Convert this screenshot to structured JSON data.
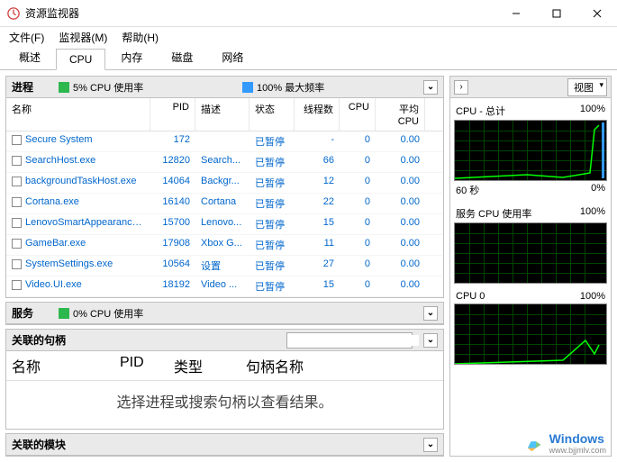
{
  "window": {
    "title": "资源监视器"
  },
  "menu": {
    "file": "文件(F)",
    "monitor": "监视器(M)",
    "help": "帮助(H)"
  },
  "tabs": [
    "概述",
    "CPU",
    "内存",
    "磁盘",
    "网络"
  ],
  "active_tab": "CPU",
  "processes": {
    "title": "进程",
    "legend1_box_color": "#2db84d",
    "legend1_text": "5% CPU 使用率",
    "legend2_box_color": "#3399ff",
    "legend2_text": "100% 最大频率",
    "columns": {
      "name": "名称",
      "pid": "PID",
      "desc": "描述",
      "status": "状态",
      "threads": "线程数",
      "cpu": "CPU",
      "avgcpu": "平均 CPU"
    },
    "rows": [
      {
        "name": "Secure System",
        "pid": "172",
        "desc": "",
        "status": "已暂停",
        "threads": "-",
        "cpu": "0",
        "avgcpu": "0.00"
      },
      {
        "name": "SearchHost.exe",
        "pid": "12820",
        "desc": "Search...",
        "status": "已暂停",
        "threads": "66",
        "cpu": "0",
        "avgcpu": "0.00"
      },
      {
        "name": "backgroundTaskHost.exe",
        "pid": "14064",
        "desc": "Backgr...",
        "status": "已暂停",
        "threads": "12",
        "cpu": "0",
        "avgcpu": "0.00"
      },
      {
        "name": "Cortana.exe",
        "pid": "16140",
        "desc": "Cortana",
        "status": "已暂停",
        "threads": "22",
        "cpu": "0",
        "avgcpu": "0.00"
      },
      {
        "name": "LenovoSmartAppearance.exe",
        "pid": "15700",
        "desc": "Lenovo...",
        "status": "已暂停",
        "threads": "15",
        "cpu": "0",
        "avgcpu": "0.00"
      },
      {
        "name": "GameBar.exe",
        "pid": "17908",
        "desc": "Xbox G...",
        "status": "已暂停",
        "threads": "11",
        "cpu": "0",
        "avgcpu": "0.00"
      },
      {
        "name": "SystemSettings.exe",
        "pid": "10564",
        "desc": "设置",
        "status": "已暂停",
        "threads": "27",
        "cpu": "0",
        "avgcpu": "0.00"
      },
      {
        "name": "Video.UI.exe",
        "pid": "18192",
        "desc": "Video ...",
        "status": "已暂停",
        "threads": "15",
        "cpu": "0",
        "avgcpu": "0.00"
      }
    ]
  },
  "services": {
    "title": "服务",
    "legend_box_color": "#2db84d",
    "legend_text": "0% CPU 使用率"
  },
  "handles": {
    "title": "关联的句柄",
    "columns": {
      "name": "名称",
      "pid": "PID",
      "type": "类型",
      "hname": "句柄名称"
    },
    "message": "选择进程或搜索句柄以查看结果。"
  },
  "modules": {
    "title": "关联的模块"
  },
  "right": {
    "view_label": "视图",
    "graphs": [
      {
        "title": "CPU - 总计",
        "pct": "100%",
        "foot_l": "60 秒",
        "foot_r": "0%"
      },
      {
        "title": "服务 CPU 使用率",
        "pct": "100%"
      },
      {
        "title": "CPU 0",
        "pct": "100%"
      }
    ]
  },
  "watermark": {
    "brand": "Windows",
    "sub": "www.bjjmlv.com"
  }
}
